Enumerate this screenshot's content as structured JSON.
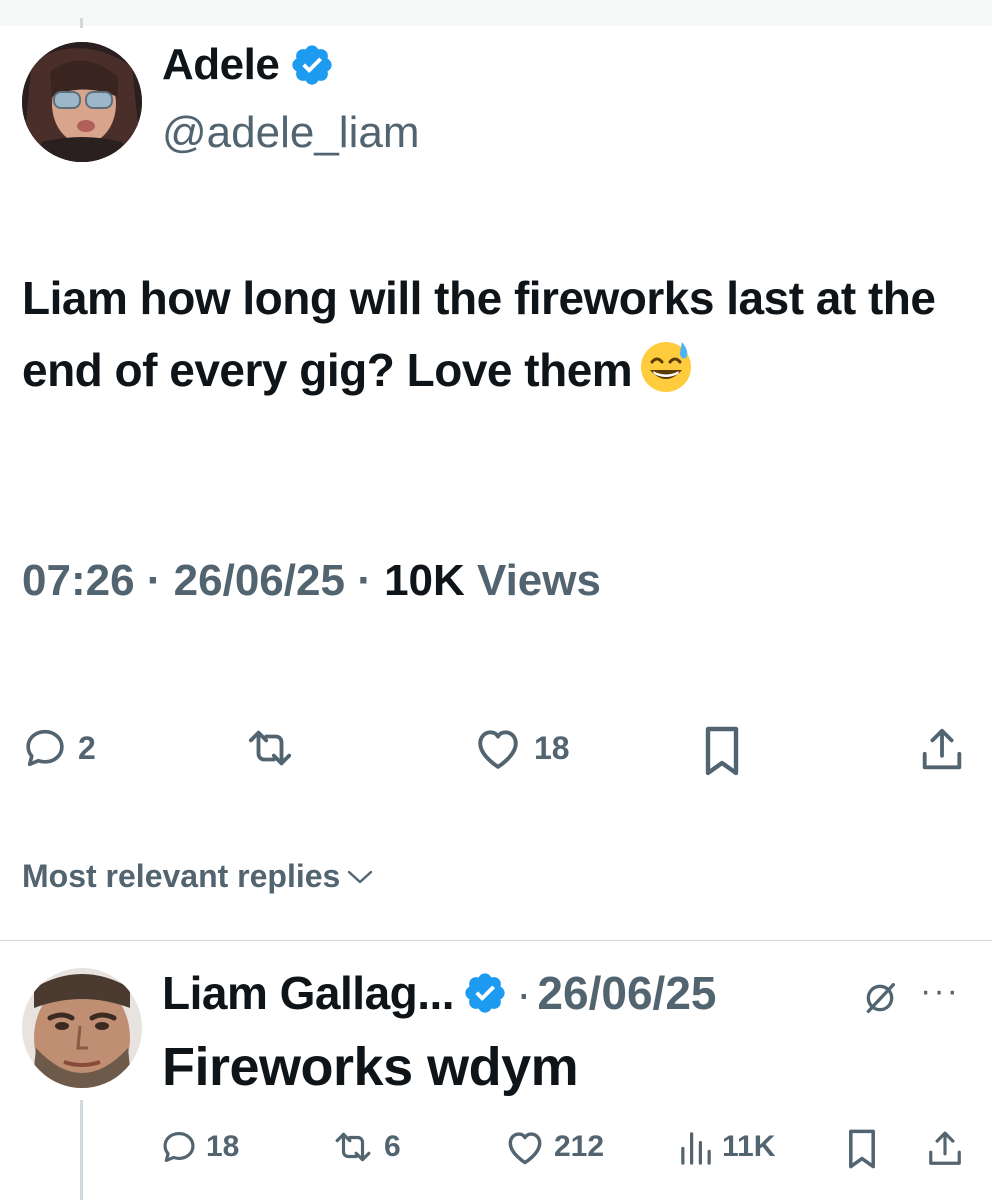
{
  "main_tweet": {
    "author_name": "Adele",
    "handle": "@adele_liam",
    "text": "Liam how long will the fireworks last at the end of every gig? Love them",
    "emoji": "grinning-sweat-emoji",
    "time": "07:26",
    "separator": "·",
    "date": "26/06/25",
    "views_count": "10K",
    "views_label": "Views",
    "actions": {
      "reply_count": "2",
      "retweet_count": "",
      "like_count": "18"
    }
  },
  "replies_filter": {
    "label": "Most relevant replies"
  },
  "reply": {
    "author_name": "Liam Gallag...",
    "separator": "·",
    "date": "26/06/25",
    "more": "···",
    "text": "Fireworks wdym",
    "actions": {
      "reply_count": "18",
      "retweet_count": "6",
      "like_count": "212",
      "views_count": "11K"
    }
  },
  "colors": {
    "text": "#0f1419",
    "muted": "#536471",
    "verified": "#1d9bf0",
    "divider": "#cfd9de"
  }
}
